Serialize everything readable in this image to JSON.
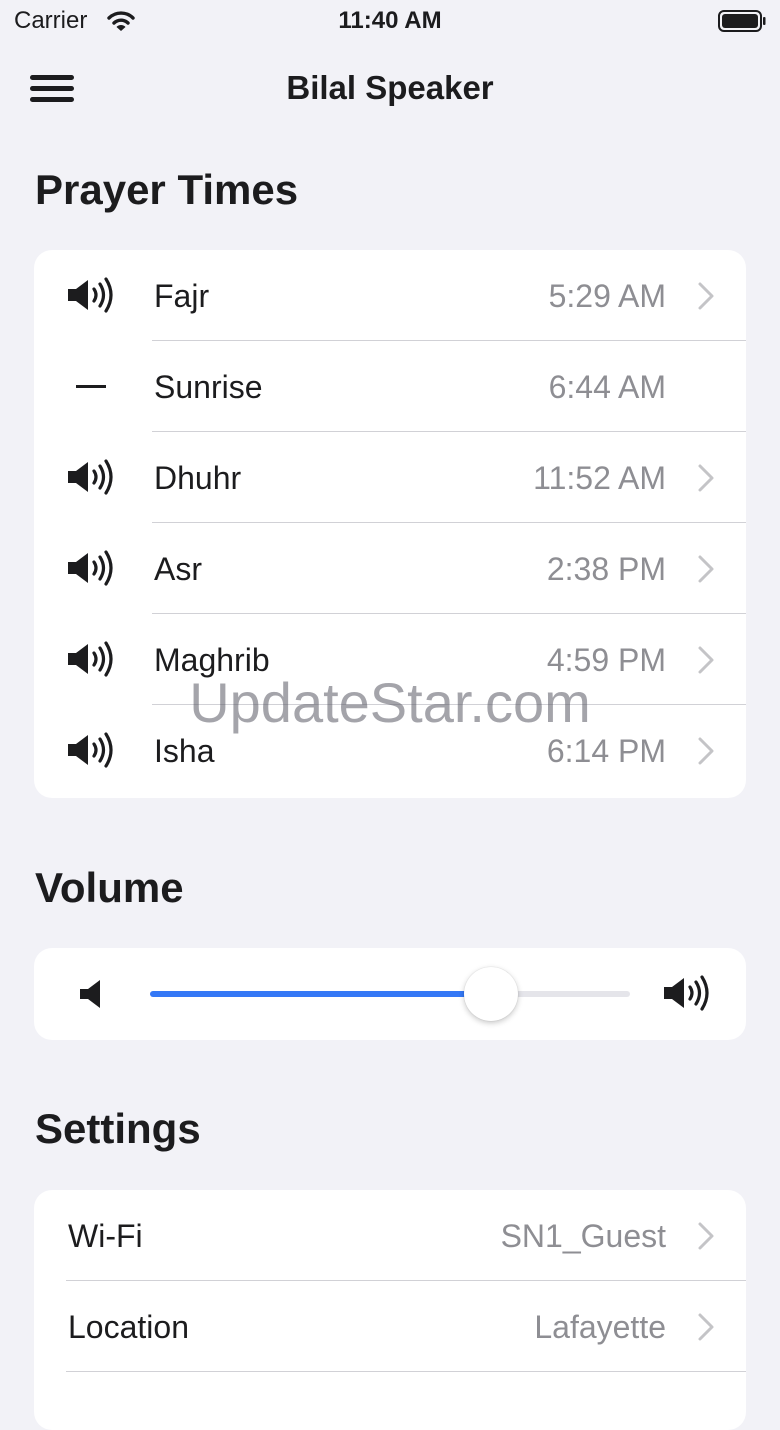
{
  "status_bar": {
    "carrier": "Carrier",
    "time": "11:40 AM"
  },
  "nav": {
    "title": "Bilal Speaker",
    "menu_icon": "hamburger-menu-icon"
  },
  "prayer_times": {
    "heading": "Prayer Times",
    "rows": [
      {
        "name": "Fajr",
        "time": "5:29 AM",
        "icon": "speaker-icon",
        "disclosure": true
      },
      {
        "name": "Sunrise",
        "time": "6:44 AM",
        "icon": "dash-icon",
        "disclosure": false
      },
      {
        "name": "Dhuhr",
        "time": "11:52 AM",
        "icon": "speaker-icon",
        "disclosure": true
      },
      {
        "name": "Asr",
        "time": "2:38 PM",
        "icon": "speaker-icon",
        "disclosure": true
      },
      {
        "name": "Maghrib",
        "time": "4:59 PM",
        "icon": "speaker-icon",
        "disclosure": true
      },
      {
        "name": "Isha",
        "time": "6:14 PM",
        "icon": "speaker-icon",
        "disclosure": true
      }
    ]
  },
  "volume": {
    "heading": "Volume",
    "level": 0.71,
    "accent": "#3478f6"
  },
  "settings": {
    "heading": "Settings",
    "rows": [
      {
        "label": "Wi-Fi",
        "value": "SN1_Guest"
      },
      {
        "label": "Location",
        "value": "Lafayette"
      }
    ]
  },
  "watermark": "UpdateStar.com"
}
